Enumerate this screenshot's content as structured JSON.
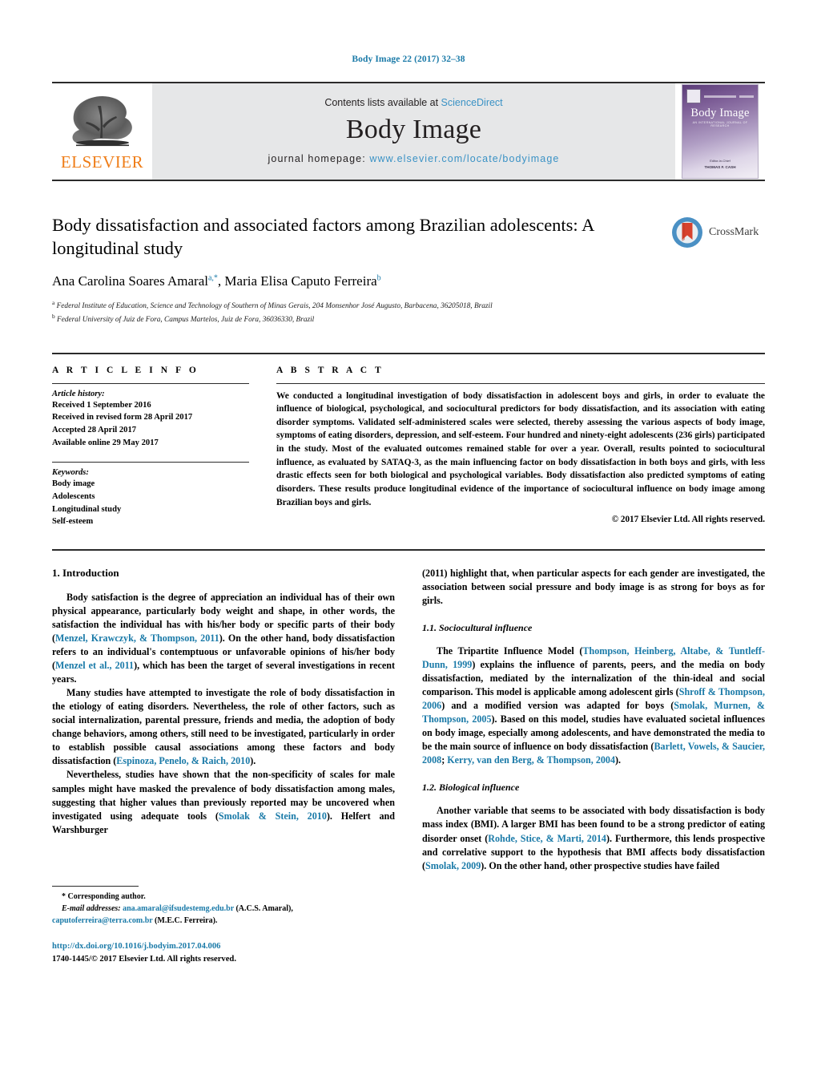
{
  "running_head": "Body Image 22 (2017) 32–38",
  "masthead": {
    "publisher_name": "ELSEVIER",
    "contents_prefix": "Contents lists available at ",
    "contents_link": "ScienceDirect",
    "journal_title": "Body Image",
    "homepage_prefix": "journal homepage: ",
    "homepage_url": "www.elsevier.com/locate/bodyimage",
    "cover": {
      "title": "Body Image",
      "subtitle": "AN INTERNATIONAL JOURNAL OF RESEARCH",
      "footer_line1": "Editor-in-Chief",
      "footer_line2": "THOMAS F. CASH"
    }
  },
  "article": {
    "title": "Body dissatisfaction and associated factors among Brazilian adolescents: A longitudinal study",
    "authors": [
      {
        "name": "Ana Carolina Soares Amaral",
        "marks": "a,*"
      },
      {
        "name": "Maria Elisa Caputo Ferreira",
        "marks": "b"
      }
    ],
    "authors_separator": ", ",
    "affiliations": [
      {
        "mark": "a",
        "text": "Federal Institute of Education, Science and Technology of Southern of Minas Gerais, 204 Monsenhor José Augusto, Barbacena, 36205018, Brazil"
      },
      {
        "mark": "b",
        "text": "Federal University of Juiz de Fora, Campus Martelos, Juiz de Fora, 36036330, Brazil"
      }
    ],
    "crossmark_label": "CrossMark"
  },
  "article_info": {
    "heading": "A R T I C L E   I N F O",
    "history_label": "Article history:",
    "history": [
      "Received 1 September 2016",
      "Received in revised form 28 April 2017",
      "Accepted 28 April 2017",
      "Available online 29 May 2017"
    ],
    "keywords_label": "Keywords:",
    "keywords": [
      "Body image",
      "Adolescents",
      "Longitudinal study",
      "Self-esteem"
    ]
  },
  "abstract": {
    "heading": "A B S T R A C T",
    "text": "We conducted a longitudinal investigation of body dissatisfaction in adolescent boys and girls, in order to evaluate the influence of biological, psychological, and sociocultural predictors for body dissatisfaction, and its association with eating disorder symptoms. Validated self-administered scales were selected, thereby assessing the various aspects of body image, symptoms of eating disorders, depression, and self-esteem. Four hundred and ninety-eight adolescents (236 girls) participated in the study. Most of the evaluated outcomes remained stable for over a year. Overall, results pointed to sociocultural influence, as evaluated by SATAQ-3, as the main influencing factor on body dissatisfaction in both boys and girls, with less drastic effects seen for both biological and psychological variables. Body dissatisfaction also predicted symptoms of eating disorders. These results produce longitudinal evidence of the importance of sociocultural influence on body image among Brazilian boys and girls.",
    "copyright": "© 2017 Elsevier Ltd. All rights reserved."
  },
  "body": {
    "section_heading": "1. Introduction",
    "left_paragraphs": [
      {
        "parts": [
          {
            "t": "Body satisfaction is the degree of appreciation an individual has of their own physical appearance, particularly body weight and shape, in other words, the satisfaction the individual has with his/her body or specific parts of their body (",
            "link": false
          },
          {
            "t": "Menzel, Krawczyk, & Thompson, 2011",
            "link": true
          },
          {
            "t": "). On the other hand, body dissatisfaction refers to an individual's contemptuous or unfavorable opinions of his/her body (",
            "link": false
          },
          {
            "t": "Menzel et al., 2011",
            "link": true
          },
          {
            "t": "), which has been the target of several investigations in recent years.",
            "link": false
          }
        ]
      },
      {
        "parts": [
          {
            "t": "Many studies have attempted to investigate the role of body dissatisfaction in the etiology of eating disorders. Nevertheless, the role of other factors, such as social internalization, parental pressure, friends and media, the adoption of body change behaviors, among others, still need to be investigated, particularly in order to establish possible causal associations among these factors and body dissatisfaction (",
            "link": false
          },
          {
            "t": "Espinoza, Penelo, & Raich, 2010",
            "link": true
          },
          {
            "t": ").",
            "link": false
          }
        ]
      },
      {
        "parts": [
          {
            "t": "Nevertheless, studies have shown that the non-specificity of scales for male samples might have masked the prevalence of body dissatisfaction among males, suggesting that higher values than previously reported may be uncovered when investigated using adequate tools (",
            "link": false
          },
          {
            "t": "Smolak & Stein, 2010",
            "link": true
          },
          {
            "t": "). Helfert and Warshburger",
            "link": false
          }
        ]
      }
    ],
    "right_continuation": {
      "parts": [
        {
          "t": "(2011) highlight that, when particular aspects for each gender are investigated, the association between social pressure and body image is as strong for boys as for girls.",
          "link": false
        }
      ]
    },
    "subsections": [
      {
        "heading": "1.1. Sociocultural influence",
        "paragraphs": [
          {
            "parts": [
              {
                "t": "The Tripartite Influence Model (",
                "link": false
              },
              {
                "t": "Thompson, Heinberg, Altabe, & Tuntleff-Dunn, 1999",
                "link": true
              },
              {
                "t": ") explains the influence of parents, peers, and the media on body dissatisfaction, mediated by the internalization of the thin-ideal and social comparison. This model is applicable among adolescent girls (",
                "link": false
              },
              {
                "t": "Shroff & Thompson, 2006",
                "link": true
              },
              {
                "t": ") and a modified version was adapted for boys (",
                "link": false
              },
              {
                "t": "Smolak, Murnen, & Thompson, 2005",
                "link": true
              },
              {
                "t": "). Based on this model, studies have evaluated societal influences on body image, especially among adolescents, and have demonstrated the media to be the main source of influence on body dissatisfaction (",
                "link": false
              },
              {
                "t": "Barlett, Vowels, & Saucier, 2008",
                "link": true
              },
              {
                "t": "; ",
                "link": false
              },
              {
                "t": "Kerry, van den Berg, & Thompson, 2004",
                "link": true
              },
              {
                "t": ").",
                "link": false
              }
            ]
          }
        ]
      },
      {
        "heading": "1.2. Biological influence",
        "paragraphs": [
          {
            "parts": [
              {
                "t": "Another variable that seems to be associated with body dissatisfaction is body mass index (BMI). A larger BMI has been found to be a strong predictor of eating disorder onset (",
                "link": false
              },
              {
                "t": "Rohde, Stice, & Marti, 2014",
                "link": true
              },
              {
                "t": "). Furthermore, this lends prospective and correlative support to the hypothesis that BMI affects body dissatisfaction (",
                "link": false
              },
              {
                "t": "Smolak, 2009",
                "link": true
              },
              {
                "t": "). On the other hand, other prospective studies have failed",
                "link": false
              }
            ]
          }
        ]
      }
    ]
  },
  "footnote": {
    "corresponding": "* Corresponding author.",
    "email_label": "E-mail addresses:",
    "emails": [
      {
        "address": "ana.amaral@ifsudestemg.edu.br",
        "owner": "(A.C.S. Amaral),"
      },
      {
        "address": "caputoferreira@terra.com.br",
        "owner": "(M.E.C. Ferreira)."
      }
    ],
    "doi": "http://dx.doi.org/10.1016/j.bodyim.2017.04.006",
    "issn_line": "1740-1445/© 2017 Elsevier Ltd. All rights reserved."
  },
  "colors": {
    "link_blue": "#1a7aa8",
    "header_link_blue": "#3a92c5",
    "elsevier_orange": "#ef7d18",
    "masthead_grey": "#e6e7e8",
    "crossmark_blue": "#4a90c4",
    "crossmark_red": "#d7422e"
  }
}
